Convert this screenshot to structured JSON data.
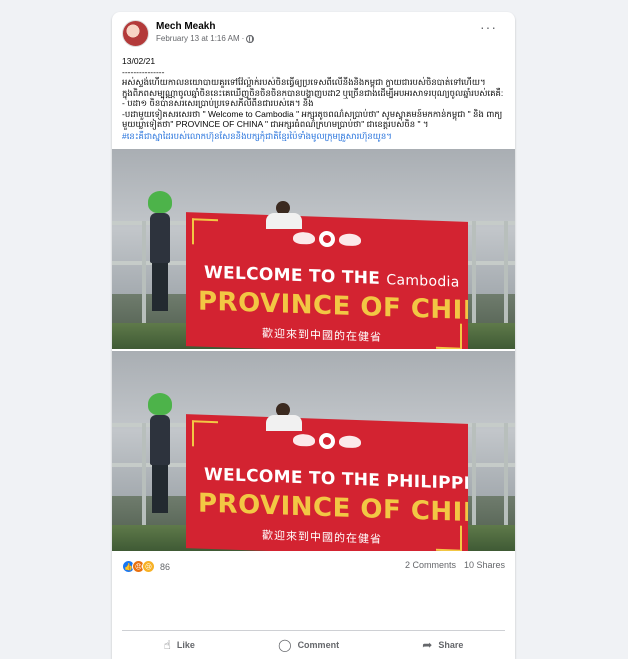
{
  "post": {
    "author": "Mech Meakh",
    "timestamp": "February 13 at 1:16 AM",
    "meta_separator": "·",
    "privacy_icon": "globe-icon",
    "more_icon": "more-options-icon"
  },
  "body": {
    "date": "13/02/21",
    "divider": "---------------",
    "lines": [
      "អស់ស្ទង់ហើយកាលនយោបាយគួរទៅវ៉ែល្អ៉ាក់របស់ចិនធ្វើឲ្យប្រទេសពីលើនីងនិងកម្ពុជា ក្លាយជារបស់ចិនបាត់ទៅហើយ។",
      " ក្នុងពិភពសម្បុណ្ណាចូលឆ្នាំចិននេះគេឃើញចិនចិនចិនកបានបង្ហាញបដា2 ឬច្រើនជាងដើម្បីអបអរសាទរបុណ្យចូលឆ្នាំរបស់គេគឺ:",
      "- បដា១ ចិនបានសរសេរប្រាប់ប្រទេសភីលីពីនជារបស់គេ។ និង",
      "-បដាមួយទៀតសរសេរថា \" Welcome to Cambodia \" អក្សរតូចពណ៌សប្រាប់ថា\" សូមស្វាគមន៍មកកាន់កម្ពុជា \" និង ពាក្យមួយឃ្លាទៀតថា\" PROVINCE OF CHINA \" ជាអក្សរធំពណ៌ក្រហមប្រាប់ថា\" ជាខេត្តរបស់ចិន \" ។"
    ],
    "hashtag": "#នេះគឺជាស្នាដៃរបស់លោកហ៊ុនសែននិងបក្សកុំជាតិខ្មែរប៉ៃទាំងមូលក្រុមគ្រួសារហ៊ុនយូន។"
  },
  "photos": [
    {
      "welcome": "WELCOME TO THE",
      "place": "Cambodia",
      "province": "PROVINCE OF CHINA",
      "chinese": "歡迎來到中國的在健省"
    },
    {
      "welcome": "WELCOME TO THE",
      "place": "PHILIPPINES,",
      "province": "PROVINCE OF CHINA",
      "chinese": "歡迎來到中國的在健省"
    }
  ],
  "stats": {
    "reaction_count": "86",
    "comments": "2 Comments",
    "shares": "10 Shares",
    "reaction_icons": [
      "like-icon",
      "angry-icon",
      "sad-icon"
    ]
  },
  "actions": {
    "like": "Like",
    "comment": "Comment",
    "share": "Share"
  },
  "colors": {
    "page_background": "#f0f2f5",
    "card_background": "#ffffff",
    "link_blue": "#216fdb",
    "secondary_text": "#65676b",
    "banner_red": "#d32331",
    "banner_yellow": "#f2c744",
    "like_blue": "#1877f2"
  }
}
